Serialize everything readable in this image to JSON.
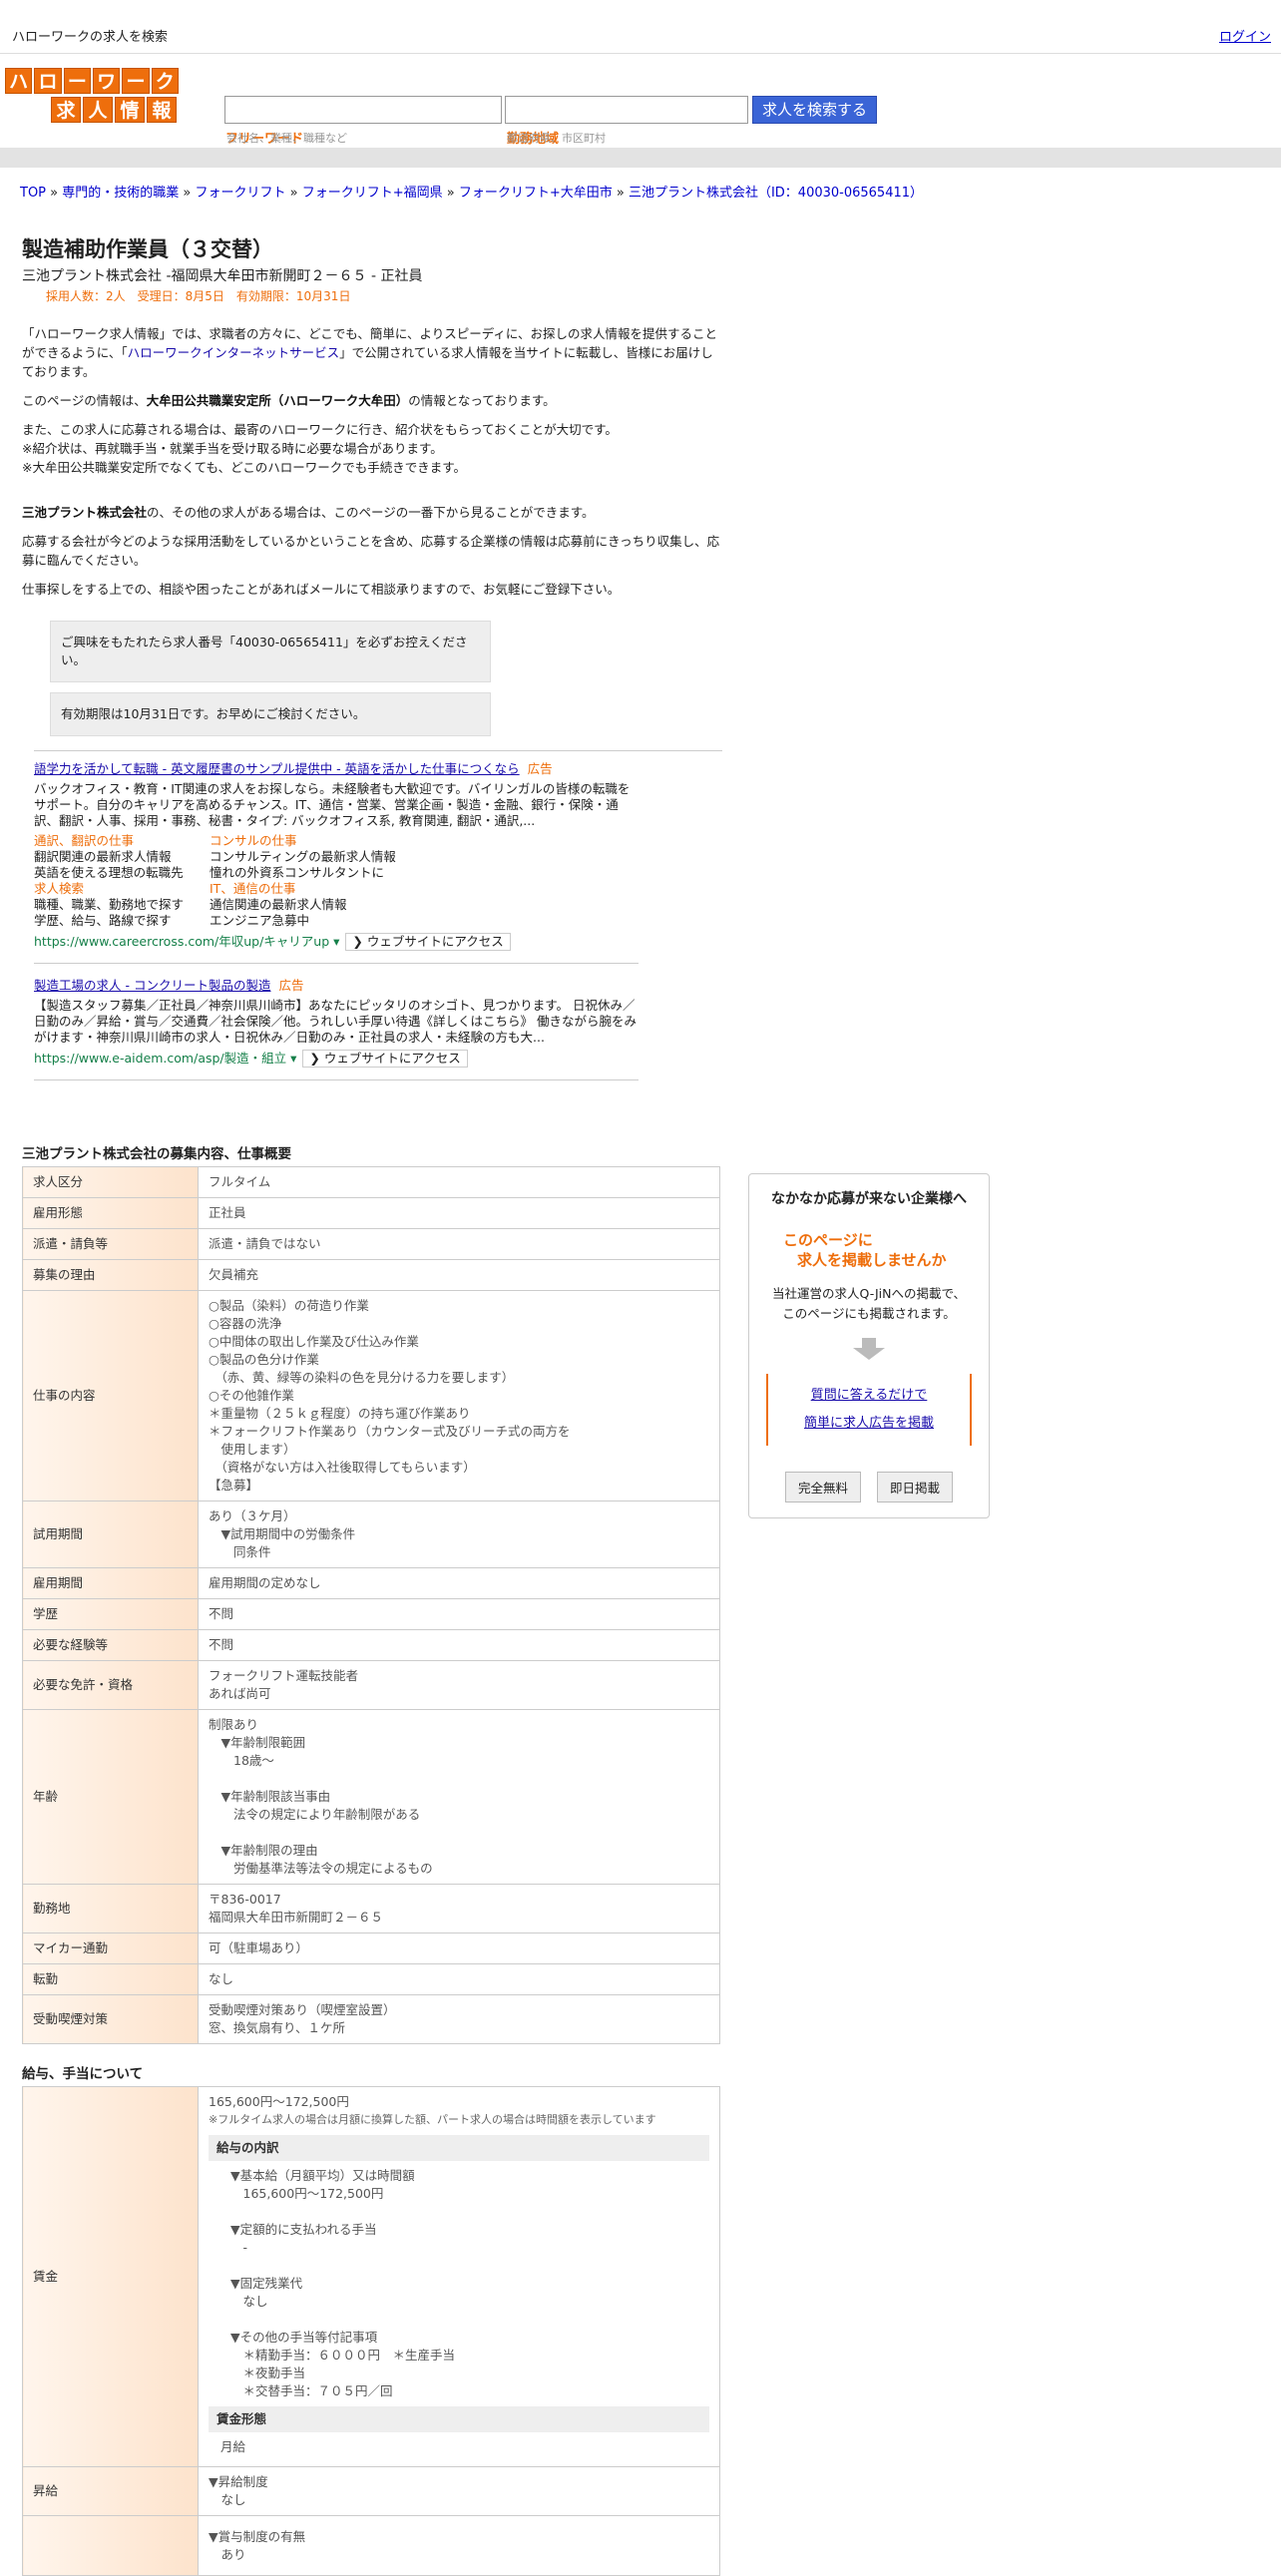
{
  "topbar": {
    "site_title": "ハローワークの求人を検索",
    "login": "ログイン"
  },
  "logo": {
    "row1": [
      "ハ",
      "ロ",
      "ー",
      "ワ",
      "ー",
      "ク"
    ],
    "row2": [
      "求",
      "人",
      "情",
      "報"
    ]
  },
  "search": {
    "keyword_label": "フリーワード",
    "keyword_hint": "会社名、業種、職種など",
    "area_label": "勤務地域",
    "area_hint": "都道府県、市区町村",
    "button": "求人を検索する"
  },
  "breadcrumb": {
    "items": [
      "TOP",
      "専門的・技術的職業",
      "フォークリフト",
      "フォークリフト+福岡県",
      "フォークリフト+大牟田市",
      "三池プラント株式会社（ID：40030-06565411）"
    ],
    "sep": " » "
  },
  "job": {
    "title": "製造補助作業員（３交替）",
    "company_line": "三池プラント株式会社 -福岡県大牟田市新開町２－６５ - 正社員",
    "meta": "採用人数：2人　受理日：8月5日　有効期限：10月31日"
  },
  "intro": {
    "p1_pre": "「ハローワーク求人情報」では、求職者の方々に、どこでも、簡単に、よりスピーディに、お探しの求人情報を提供することができるように、「",
    "p1_link": "ハローワークインターネットサービス",
    "p1_post": "」で公開されている求人情報を当サイトに転載し、皆様にお届けしております。",
    "p2_pre": "このページの情報は、",
    "p2_strong": "大牟田公共職業安定所（ハローワーク大牟田）",
    "p2_post": "の情報となっております。",
    "p3a": "また、この求人に応募される場合は、最寄のハローワークに行き、紹介状をもらっておくことが大切です。",
    "p3b": "※紹介状は、再就職手当・就業手当を受け取る時に必要な場合があります。",
    "p3c": "※大牟田公共職業安定所でなくても、どこのハローワークでも手続きできます。",
    "p4_strong": "三池プラント株式会社",
    "p4_post": "の、その他の求人がある場合は、このページの一番下から見ることができます。",
    "p5": "応募する会社が今どのような採用活動をしているかということを含め、応募する企業様の情報は応募前にきっちり収集し、応募に臨んでください。",
    "p6": "仕事探しをする上での、相談や困ったことがあればメールにて相談承りますので、お気軽にご登録下さい。"
  },
  "notices": {
    "n1": "ご興味をもたれたら求人番号「40030-06565411」を必ずお控えください。",
    "n2": "有効期限は10月31日です。お早めにご検討ください。"
  },
  "ads": [
    {
      "title": "語学力を活かして転職 - 英文履歴書のサンプル提供中 - 英語を活かした仕事につくなら",
      "badge": "広告",
      "desc": "バックオフィス・教育・IT関連の求人をお探しなら。未経験者も大歓迎です。バイリンガルの皆様の転職をサポート。自分のキャリアを高めるチャンス。IT、通信・営業、営業企画・製造・金融、銀行・保険・通訳、翻訳・人事、採用・事務、秘書・タイプ: バックオフィス系, 教育関連, 翻訳・通訳,...",
      "sitelinks": [
        {
          "head": "通訳、翻訳の仕事",
          "lines": [
            "翻訳関連の最新求人情報",
            "英語を使える理想の転職先"
          ]
        },
        {
          "head": "コンサルの仕事",
          "lines": [
            "コンサルティングの最新求人情報",
            "憧れの外資系コンサルタントに"
          ]
        },
        {
          "head": "求人検索",
          "lines": [
            "職種、職業、勤務地で探す",
            "学歴、給与、路線で探す"
          ]
        },
        {
          "head": "IT、通信の仕事",
          "lines": [
            "通信関連の最新求人情報",
            "エンジニア急募中"
          ]
        }
      ],
      "url": "https://www.careercross.com/年収up/キャリアup ▾",
      "visit": "❯ ウェブサイトにアクセス"
    },
    {
      "title": "製造工場の求人 - コンクリート製品の製造",
      "badge": "広告",
      "desc": "【製造スタッフ募集／正社員／神奈川県川崎市】あなたにピッタリのオシゴト、見つかります。 日祝休み／日勤のみ／昇給・賞与／交通費／社会保険／他。うれしい手厚い待遇《詳しくはこちら》 働きながら腕をみがけます・神奈川県川崎市の求人・日祝休み／日勤のみ・正社員の求人・未経験の方も大...",
      "sitelinks": [],
      "url": "https://www.e-aidem.com/asp/製造・組立 ▾",
      "visit": "❯ ウェブサイトにアクセス"
    }
  ],
  "job_table": {
    "title": "三池プラント株式会社の募集内容、仕事概要",
    "rows": [
      {
        "label": "求人区分",
        "lines": [
          "フルタイム"
        ]
      },
      {
        "label": "雇用形態",
        "lines": [
          "正社員"
        ]
      },
      {
        "label": "派遣・請負等",
        "lines": [
          "派遣・請負ではない"
        ]
      },
      {
        "label": "募集の理由",
        "lines": [
          "欠員補充"
        ]
      },
      {
        "label": "仕事の内容",
        "lines": [
          "○製品（染料）の荷造り作業",
          "○容器の洗浄",
          "○中間体の取出し作業及び仕込み作業",
          "○製品の色分け作業",
          "　（赤、黄、緑等の染料の色を見分ける力を要します）",
          "○その他雑作業",
          "＊重量物（２５ｋｇ程度）の持ち運び作業あり",
          "＊フォークリフト作業あり（カウンター式及びリーチ式の両方を",
          "　使用します）",
          "　（資格がない方は入社後取得してもらいます）",
          "【急募】"
        ]
      },
      {
        "label": "試用期間",
        "lines": [
          "あり（３ケ月）",
          "　▼試用期間中の労働条件",
          "　　同条件"
        ]
      },
      {
        "label": "雇用期間",
        "lines": [
          "雇用期間の定めなし"
        ]
      },
      {
        "label": "学歴",
        "lines": [
          "不問"
        ]
      },
      {
        "label": "必要な経験等",
        "lines": [
          "不問"
        ]
      },
      {
        "label": "必要な免許・資格",
        "lines": [
          "フォークリフト運転技能者",
          "あれば尚可"
        ]
      },
      {
        "label": "年齢",
        "lines": [
          "制限あり",
          "　▼年齢制限範囲",
          "　　18歳〜",
          "",
          "　▼年齢制限該当事由",
          "　　法令の規定により年齢制限がある",
          "",
          "　▼年齢制限の理由",
          "　　労働基準法等法令の規定によるもの"
        ]
      },
      {
        "label": "勤務地",
        "lines": [
          "〒836-0017",
          "福岡県大牟田市新開町２－６５"
        ]
      },
      {
        "label": "マイカー通勤",
        "lines": [
          "可（駐車場あり）"
        ]
      },
      {
        "label": "転勤",
        "lines": [
          "なし"
        ]
      },
      {
        "label": "受動喫煙対策",
        "lines": [
          "受動喫煙対策あり（喫煙室設置）",
          "窓、換気扇有り、１ケ所"
        ]
      }
    ]
  },
  "salary": {
    "title": "給与、手当について",
    "wage_label": "賃金",
    "wage_range": "165,600円〜172,500円",
    "wage_note": "※フルタイム求人の場合は月額に換算した額、パート求人の場合は時間額を表示しています",
    "breakdown_head": "給与の内訳",
    "breakdown": [
      "▼基本給（月額平均）又は時間額",
      "　165,600円〜172,500円",
      "",
      "▼定額的に支払われる手当",
      "　-",
      "",
      "▼固定残業代",
      "　なし",
      "",
      "▼その他の手当等付記事項",
      "　＊精勤手当：６０００円　＊生産手当",
      "　＊夜勤手当",
      "　＊交替手当：７０５円／回"
    ],
    "form_head": "賃金形態",
    "form_value": "月給",
    "raise_label": "昇給",
    "raise_lines": [
      "▼昇給制度",
      "　なし"
    ],
    "bonus_lines": [
      "▼賞与制度の有無",
      "　あり"
    ]
  },
  "sidebox": {
    "title": "なかなか応募が来ない企業様へ",
    "catch1": "このページに",
    "catch2": "求人を掲載しませんか",
    "text1": "当社運営の求人Q-JiNへの掲載で、",
    "text2": "このページにも掲載されます。",
    "link1": "質問に答えるだけで",
    "link2": "簡単に求人広告を掲載",
    "btn1": "完全無料",
    "btn2": "即日掲載"
  }
}
